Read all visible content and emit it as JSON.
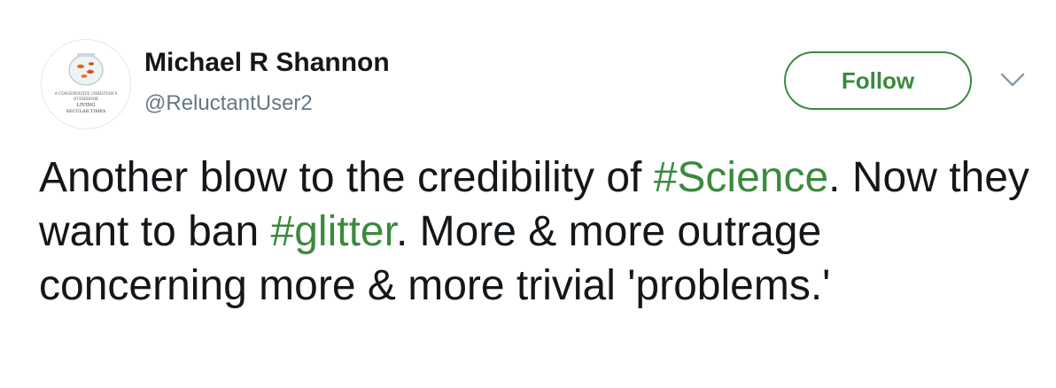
{
  "user": {
    "name": "Michael R Shannon",
    "handle": "@ReluctantUser2",
    "avatar_text": [
      "A CONSERVATIVE CHRISTIAN'S",
      "GUIDEBOOK",
      "LIVING",
      "SECULAR TIMES"
    ]
  },
  "actions": {
    "follow_label": "Follow",
    "more_icon": "chevron-down-icon"
  },
  "tweet": {
    "t1": "Another blow to the credibility of ",
    "h1": "#Science",
    "t2": ". Now they want to ban ",
    "h2": "#glitter",
    "t3": ". More & more outrage concerning more & more trivial 'problems.'"
  },
  "colors": {
    "accent": "#3b8a3e",
    "text": "#14171a",
    "secondary": "#657786"
  }
}
